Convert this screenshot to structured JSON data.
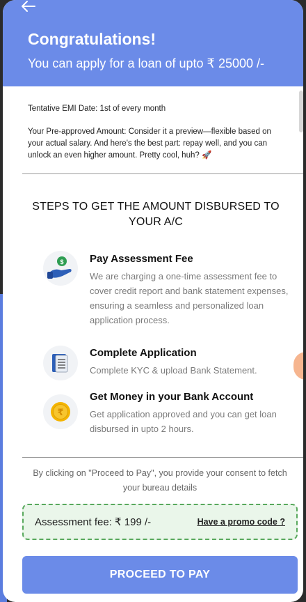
{
  "header": {
    "title": "Congratulations!",
    "subtitle": "You can apply for a loan of upto ₹ 25000 /-",
    "back_icon": "arrow-left-icon"
  },
  "info": {
    "emi_date": "Tentative EMI Date: 1st of every month",
    "preapproved": "Your Pre-approved Amount: Consider it a preview—flexible based on your actual salary. And here's the best part: repay well, and you can unlock an even higher amount. Pretty cool, huh? 🚀"
  },
  "steps": {
    "heading": "STEPS TO GET THE AMOUNT DISBURSED TO YOUR A/C",
    "items": [
      {
        "icon": "hand-coin-icon",
        "title": "Pay Assessment Fee",
        "desc": "We are charging a one-time assessment fee to cover credit report and bank statement expenses, ensuring a seamless and personalized loan application process."
      },
      {
        "icon": "document-icon",
        "title": "Complete Application",
        "desc": "Complete KYC & upload Bank Statement."
      },
      {
        "icon": "rupee-coin-icon",
        "title": "Get Money in your Bank Account",
        "desc": "Get application approved and you can get loan disbursed in upto 2 hours."
      }
    ]
  },
  "consent": "By clicking on \"Proceed to Pay\", you provide your consent to fetch your bureau details",
  "fee": {
    "label": "Assessment fee: ₹ 199 /-",
    "promo_link": "Have a promo code ?"
  },
  "cta": {
    "label": "PROCEED TO PAY"
  },
  "colors": {
    "primary": "#6b8be8",
    "fee_bg": "#eaf6ea",
    "fee_border": "#59a95d"
  }
}
